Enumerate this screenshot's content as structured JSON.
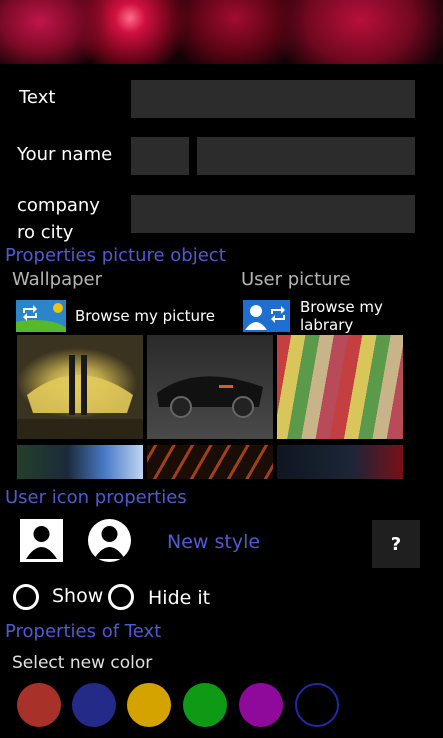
{
  "form": {
    "text_label": "Text",
    "text_value": "",
    "name_label": "Your name",
    "first_name_value": "",
    "last_name_value": "",
    "company_label_line1": "company",
    "company_label_line2": "ro city",
    "company_value": ""
  },
  "picture": {
    "section_title": "Properties picture object",
    "wallpaper_label": "Wallpaper",
    "user_picture_label": "User picture",
    "browse_picture_label": "Browse my picture",
    "browse_library_label": "Browse my labrary",
    "thumbnails": [
      "yellow-sports-car",
      "black-sports-car",
      "striped-wood",
      "city-lights",
      "dark-orange-abstract",
      "red-car-detail"
    ]
  },
  "user_icon": {
    "section_title": "User icon properties",
    "new_style_label": "New style",
    "help_label": "?",
    "show_label": "Show",
    "hide_label": "Hide it"
  },
  "text_props": {
    "section_title": "Properties of Text",
    "select_color_label": "Select new color",
    "colors": [
      "#a8312a",
      "#232a87",
      "#d4a300",
      "#0f9a16",
      "#8f0a9a",
      "#000000"
    ],
    "colors_outline": "#1e2aa8"
  }
}
